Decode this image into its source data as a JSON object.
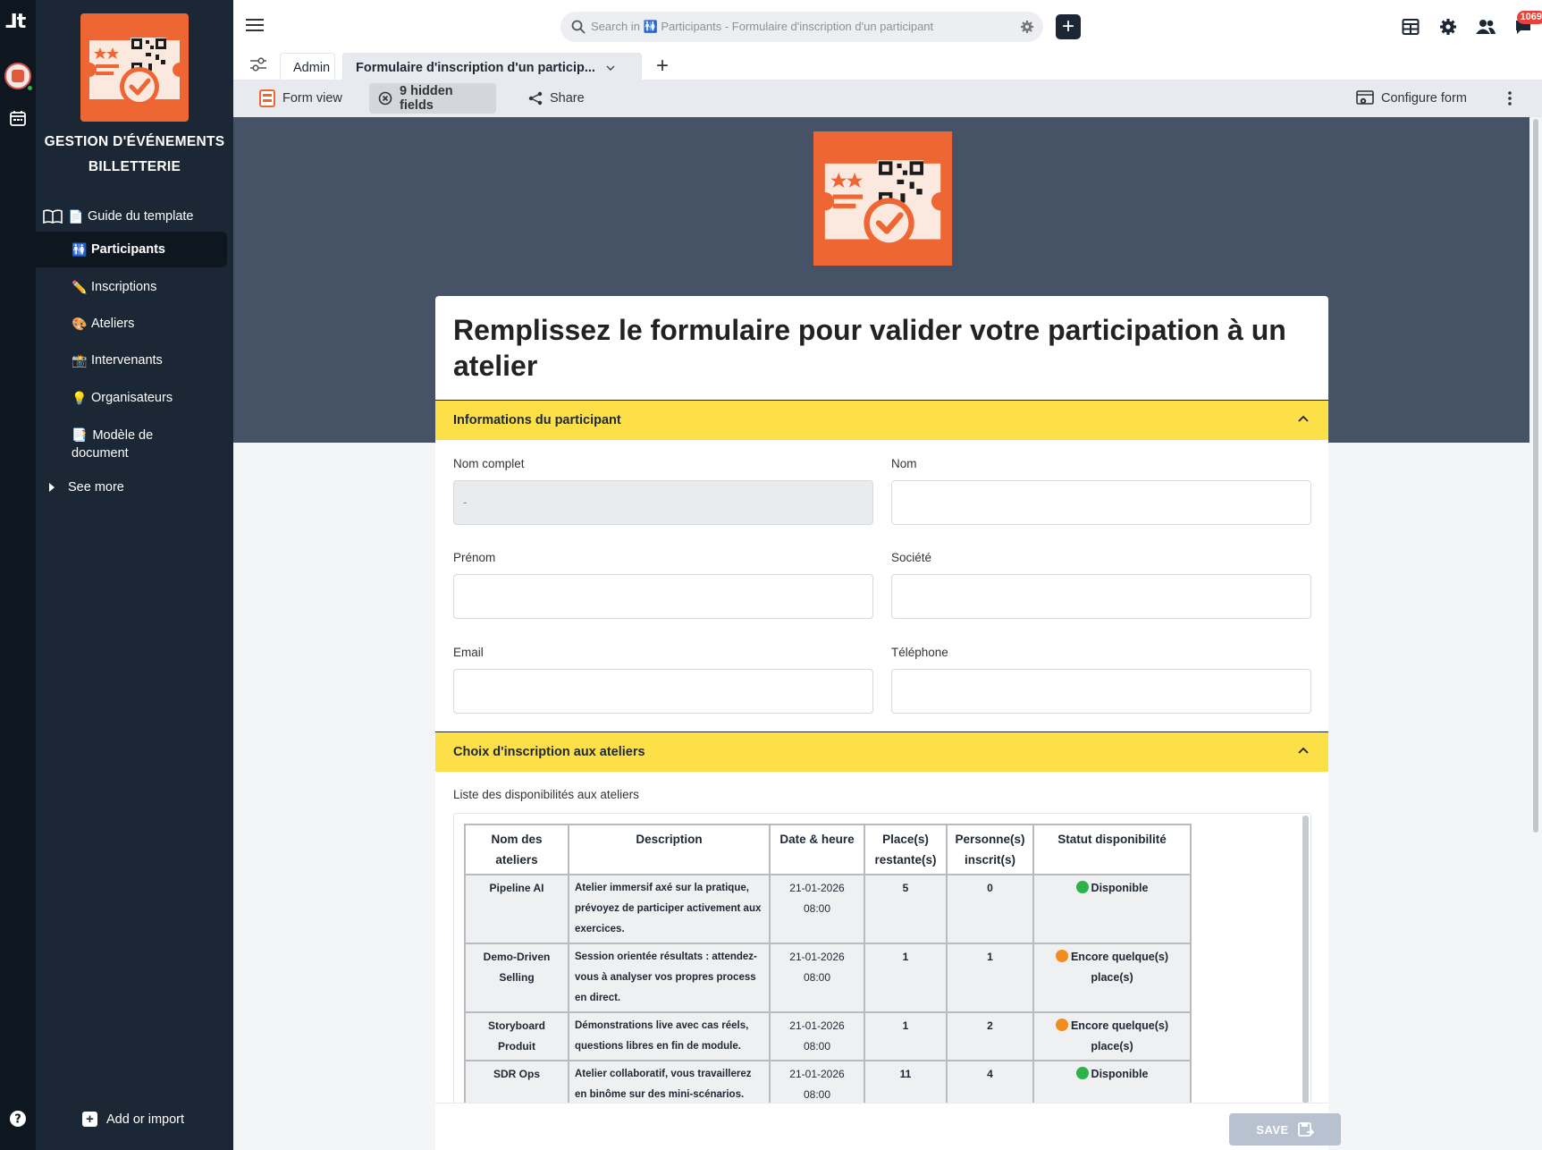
{
  "rail": {
    "logo": "ᒧt"
  },
  "sidebar": {
    "workspace_title_1": "GESTION D'ÉVÉNEMENTS",
    "workspace_title_2": "BILLETTERIE",
    "items": [
      {
        "emoji": "📄",
        "label": "Guide du template"
      },
      {
        "emoji": "🚻",
        "label": "Participants"
      },
      {
        "emoji": "✏️",
        "label": "Inscriptions"
      },
      {
        "emoji": "🎨",
        "label": "Ateliers"
      },
      {
        "emoji": "📸",
        "label": "Intervenants"
      },
      {
        "emoji": "💡",
        "label": "Organisateurs"
      },
      {
        "emoji": "📑",
        "label": "Modèle de document"
      }
    ],
    "see_more": "See more",
    "add_or_import": "Add or import"
  },
  "header": {
    "search_placeholder": "Search in 🚻 Participants - Formulaire d'inscription d'un participant",
    "notifications_count": "1069"
  },
  "tabs": [
    {
      "label": "Admin"
    },
    {
      "label": "Formulaire d'inscription d'un particip..."
    }
  ],
  "view_bar": {
    "form_view": "Form view",
    "hidden_fields": "9 hidden fields",
    "share": "Share",
    "configure_form": "Configure form"
  },
  "form": {
    "title": "Remplissez le formulaire pour valider votre participation à un atelier",
    "section1": "Informations du participant",
    "fields": {
      "nom_complet": {
        "label": "Nom complet",
        "value": "-"
      },
      "nom": {
        "label": "Nom"
      },
      "prenom": {
        "label": "Prénom"
      },
      "societe": {
        "label": "Société"
      },
      "email": {
        "label": "Email"
      },
      "telephone": {
        "label": "Téléphone"
      }
    },
    "section2": "Choix d'inscription aux ateliers",
    "list_label": "Liste des disponibilités aux ateliers",
    "save_label": "SAVE"
  },
  "workshops": {
    "columns": [
      "Nom des ateliers",
      "Description",
      "Date & heure",
      "Place(s) restante(s)",
      "Personne(s) inscrit(s)",
      "Statut disponibilité"
    ],
    "rows": [
      {
        "name": "Pipeline AI",
        "desc": "Atelier immersif axé sur la pratique, prévoyez de participer activement aux exercices.",
        "date": "21-01-2026 08:00",
        "left": "5",
        "enrolled": "0",
        "status": "Disponible",
        "status_color": "#2db34a"
      },
      {
        "name": "Demo-Driven Selling",
        "desc": "Session orientée résultats : attendez-vous à analyser vos propres process en direct.",
        "date": "21-01-2026 08:00",
        "left": "1",
        "enrolled": "1",
        "status": "Encore quelque(s) place(s)",
        "status_color": "#f28c1c"
      },
      {
        "name": "Storyboard Produit",
        "desc": "Démonstrations live avec cas réels, questions libres en fin de module.",
        "date": "21-01-2026 08:00",
        "left": "1",
        "enrolled": "2",
        "status": "Encore quelque(s) place(s)",
        "status_color": "#f28c1c"
      },
      {
        "name": "SDR Ops",
        "desc": "Atelier collaboratif, vous travaillerez en binôme sur des mini-scénarios.",
        "date": "21-01-2026 08:00",
        "left": "11",
        "enrolled": "4",
        "status": "Disponible",
        "status_color": "#2db34a"
      }
    ]
  }
}
